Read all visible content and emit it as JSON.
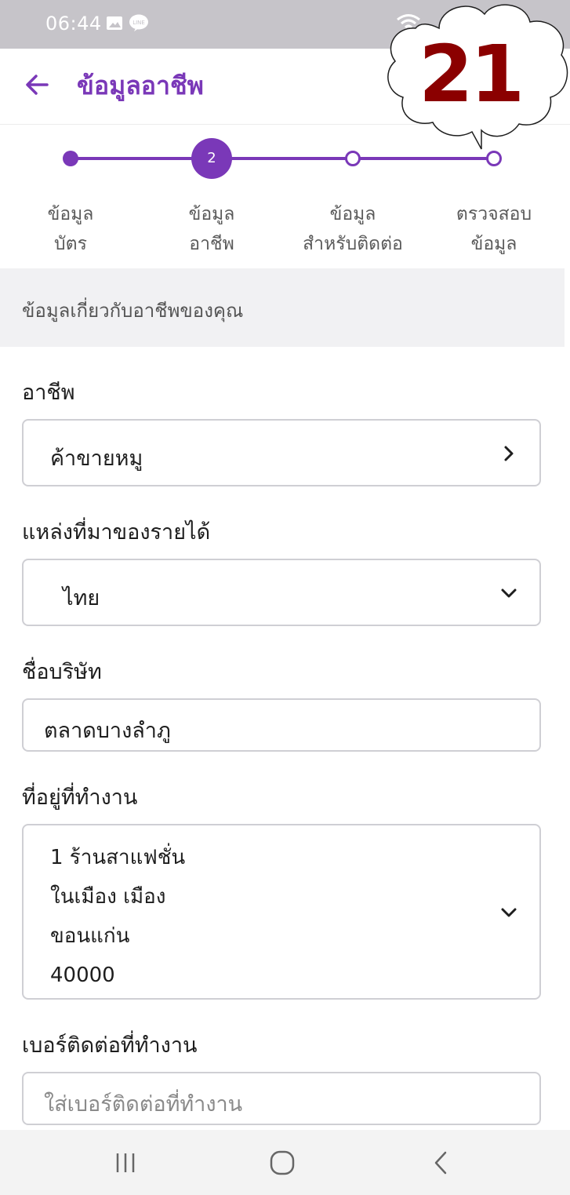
{
  "status_bar": {
    "time": "06:44",
    "icons": [
      "image-icon",
      "line-chat-icon",
      "wifi-icon"
    ]
  },
  "app_bar": {
    "back_icon": "arrow-left-icon",
    "title": "ข้อมูลอาชีพ"
  },
  "stepper": {
    "current_step": 2,
    "current_step_label": "2",
    "steps": [
      {
        "line1": "ข้อมูล",
        "line2": "บัตร"
      },
      {
        "line1": "ข้อมูล",
        "line2": "อาชีพ"
      },
      {
        "line1": "ข้อมูล",
        "line2": "สำหรับติดต่อ"
      },
      {
        "line1": "ตรวจสอบ",
        "line2": "ข้อมูล"
      }
    ]
  },
  "badge": {
    "text": "21"
  },
  "section": {
    "title": "ข้อมูลเกี่ยวกับอาชีพของคุณ"
  },
  "form": {
    "occupation": {
      "label": "อาชีพ",
      "value": "ค้าขายหมู"
    },
    "income_source": {
      "label": "แหล่งที่มาของรายได้",
      "value": "ไทย"
    },
    "company_name": {
      "label": "ชื่อบริษัท",
      "value": "ตลาดบางลำภู"
    },
    "work_address": {
      "label": "ที่อยู่ที่ทำงาน",
      "lines": [
        "1 ร้านสาแฟชั่น",
        "ในเมือง เมือง",
        "ขอนแก่น",
        "40000"
      ]
    },
    "work_phone": {
      "label": "เบอร์ติดต่อที่ทำงาน",
      "placeholder": "ใส่เบอร์ติดต่อที่ทำงาน"
    }
  },
  "colors": {
    "accent": "#7a38b8",
    "status_bar": "#c6c4c9",
    "badge_text": "#8b0000",
    "section_band": "#f1f1f3"
  },
  "nav": {
    "icons": [
      "recent-apps-icon",
      "home-icon",
      "back-icon"
    ]
  }
}
